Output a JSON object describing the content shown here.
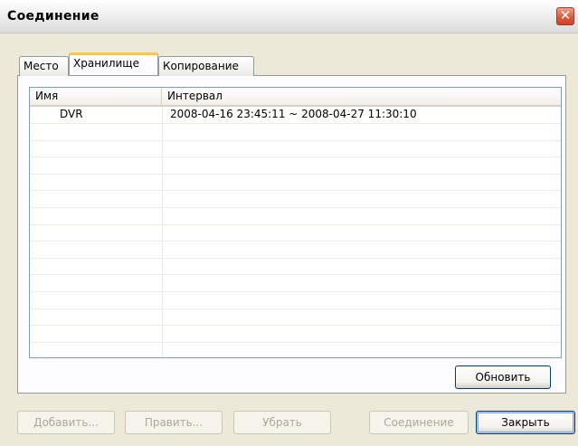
{
  "window": {
    "title": "Соединение",
    "close_icon": "✕"
  },
  "tabs": [
    {
      "label": "Место",
      "active": false
    },
    {
      "label": "Хранилище",
      "active": true
    },
    {
      "label": "Копирование",
      "active": false
    }
  ],
  "list": {
    "columns": [
      "Имя",
      "Интервал"
    ],
    "rows": [
      {
        "name": "DVR",
        "interval": "2008-04-16  23:45:11 ~ 2008-04-27  11:30:10"
      }
    ]
  },
  "buttons": {
    "refresh": "Обновить",
    "add": "Добавить...",
    "edit": "Править...",
    "remove": "Убрать",
    "connect": "Соединение",
    "close": "Закрыть"
  },
  "colors": {
    "tab_highlight": "#ffc73c",
    "button_border": "#003c74",
    "face": "#ece9d8"
  }
}
